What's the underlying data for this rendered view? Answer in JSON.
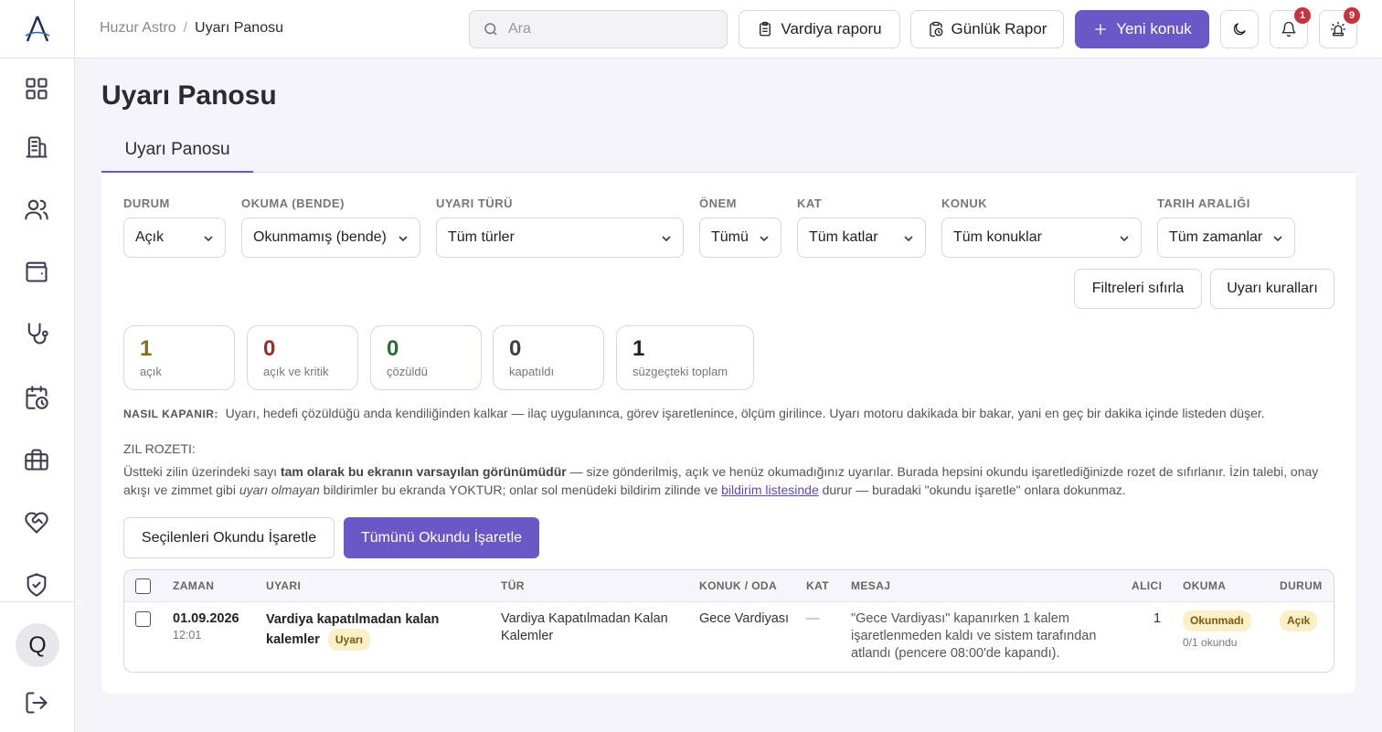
{
  "topbar": {
    "breadcrumb_root": "Huzur Astro",
    "breadcrumb_sep": "/",
    "breadcrumb_current": "Uyarı Panosu",
    "search_placeholder": "Ara",
    "shift_report": "Vardiya raporu",
    "daily_report": "Günlük Rapor",
    "new_guest": "Yeni konuk",
    "notification_count": "1",
    "alert_count": "9"
  },
  "sidebar": {
    "avatar_letter": "Q",
    "items": [
      "grid-icon",
      "building-icon",
      "users-icon",
      "wallet-icon",
      "stethoscope-icon",
      "calendar-clock-icon",
      "briefcase-icon",
      "heart-handshake-icon",
      "shield-check-icon"
    ]
  },
  "page": {
    "title": "Uyarı Panosu",
    "tab": "Uyarı Panosu"
  },
  "filters": {
    "status_label": "DURUM",
    "status_value": "Açık",
    "reading_label": "OKUMA (BENDE)",
    "reading_value": "Okunmamış (bende)",
    "type_label": "UYARI TÜRÜ",
    "type_value": "Tüm türler",
    "severity_label": "ÖNEM",
    "severity_value": "Tümü",
    "floor_label": "KAT",
    "floor_value": "Tüm katlar",
    "guest_label": "KONUK",
    "guest_value": "Tüm konuklar",
    "date_label": "TARIH ARALIĞI",
    "date_value": "Tüm zamanlar",
    "reset": "Filtreleri sıfırla",
    "rules": "Uyarı kuralları"
  },
  "stats": [
    {
      "value": "1",
      "label": "açık",
      "color": "#8a6a1c"
    },
    {
      "value": "0",
      "label": "açık ve kritik",
      "color": "#9b2c2c"
    },
    {
      "value": "0",
      "label": "çözüldü",
      "color": "#2f6b3a"
    },
    {
      "value": "0",
      "label": "kapatıldı",
      "color": "#3c3c4a"
    },
    {
      "value": "1",
      "label": "süzgeçteki toplam",
      "color": "#1f1f2b"
    }
  ],
  "info": {
    "how_caption": "NASIL KAPANIR:",
    "how_text": "Uyarı, hedefi çözüldüğü anda kendiliğinden kalkar — ilaç uygulanınca, görev işaretlenince, ölçüm girilince. Uyarı motoru dakikada bir bakar, yani en geç bir dakika içinde listeden düşer.",
    "bell_caption": "ZIL ROZETI:",
    "bell_p1": "Üstteki zilin üzerindeki sayı ",
    "bell_bold": "tam olarak bu ekranın varsayılan görünümüdür",
    "bell_p2": " — size gönderilmiş, açık ve henüz okumadığınız uyarılar. Burada hepsini okundu işaretlediğinizde rozet de sıfırlanır. İzin talebi, onay akışı ve zimmet gibi ",
    "bell_italic": "uyarı olmayan",
    "bell_p3": " bildirimler bu ekranda YOKTUR; onlar sol menüdeki bildirim zilinde ve ",
    "bell_link": "bildirim listesinde",
    "bell_p4": " durur — buradaki \"okundu işaretle\" onlara dokunmaz."
  },
  "actions": {
    "mark_selected": "Seçilenleri Okundu İşaretle",
    "mark_all": "Tümünü Okundu İşaretle"
  },
  "table": {
    "headers": {
      "time": "ZAMAN",
      "alert": "UYARI",
      "type": "TÜR",
      "guest_room": "KONUK / ODA",
      "floor": "KAT",
      "message": "MESAJ",
      "recipient": "ALICI",
      "reading": "OKUMA",
      "status": "DURUM"
    },
    "rows": [
      {
        "date": "01.09.2026",
        "time": "12:01",
        "alert": "Vardiya kapatılmadan kalan kalemler",
        "severity": "Uyarı",
        "type": "Vardiya Kapatılmadan Kalan Kalemler",
        "guest_room": "Gece Vardiyası",
        "floor": "—",
        "message": "\"Gece Vardiyası\" kapanırken 1 kalem işaretlenmeden kaldı ve sistem tarafından atlandı (pencere 08:00'de kapandı).",
        "recipient": "1",
        "reading": "Okunmadı",
        "reading_count": "0/1 okundu",
        "status": "Açık"
      }
    ]
  }
}
